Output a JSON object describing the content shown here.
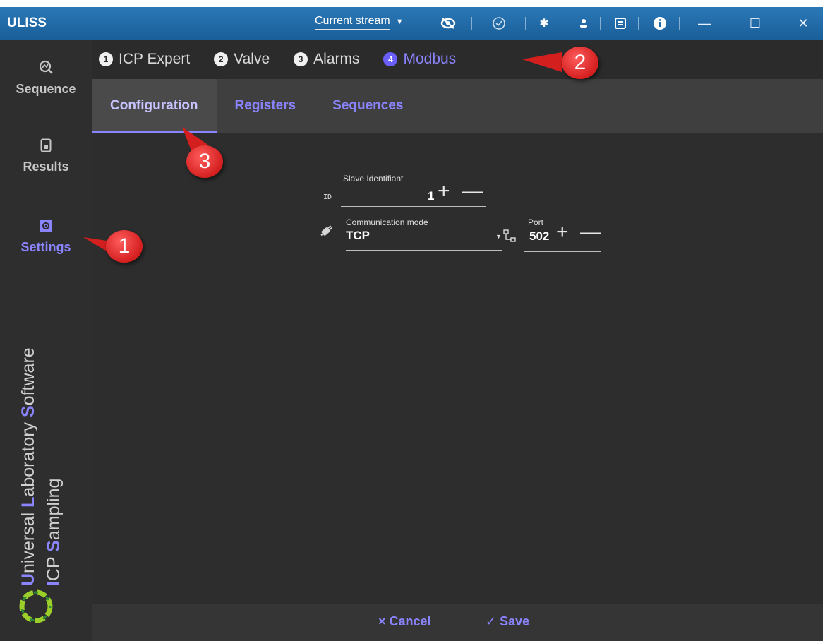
{
  "app": {
    "title": "ULISS"
  },
  "titlebar": {
    "stream_select": "Current stream",
    "icons": [
      "eye-off-icon",
      "check-circle-icon",
      "gear-icon",
      "user-icon",
      "document-icon",
      "info-icon"
    ],
    "window_buttons": [
      "—",
      "☐",
      "✕"
    ]
  },
  "sidebar": {
    "items": [
      {
        "label": "Sequence",
        "icon": "sequence-icon"
      },
      {
        "label": "Results",
        "icon": "results-icon"
      },
      {
        "label": "Settings",
        "icon": "settings-icon",
        "active": true
      }
    ],
    "tagline_line1": [
      {
        "letter": "U",
        "rest": "niversal "
      },
      {
        "letter": "L",
        "rest": "aboratory "
      },
      {
        "letter": "S",
        "rest": "oftware"
      }
    ],
    "tagline_line2": [
      {
        "letter": "I",
        "rest": "CP "
      },
      {
        "letter": "S",
        "rest": "ampling"
      }
    ]
  },
  "steps": [
    {
      "num": "1",
      "label": "ICP Expert"
    },
    {
      "num": "2",
      "label": "Valve"
    },
    {
      "num": "3",
      "label": "Alarms"
    },
    {
      "num": "4",
      "label": "Modbus",
      "active": true
    }
  ],
  "subtabs": [
    {
      "label": "Configuration",
      "active": true
    },
    {
      "label": "Registers"
    },
    {
      "label": "Sequences"
    }
  ],
  "form": {
    "slave": {
      "prefix": "ID",
      "label": "Slave Identifiant",
      "value": "1"
    },
    "comm_mode": {
      "label": "Communication mode",
      "value": "TCP"
    },
    "port": {
      "label": "Port",
      "value": "502"
    },
    "plus": "+",
    "minus": "—"
  },
  "bottom": {
    "cancel": "× Cancel",
    "save": "✓ Save"
  },
  "callouts": {
    "one": "1",
    "two": "2",
    "three": "3"
  },
  "colors": {
    "accent": "#8b84ff",
    "titlebar": "#1f6aa8",
    "callout": "#e02828"
  }
}
